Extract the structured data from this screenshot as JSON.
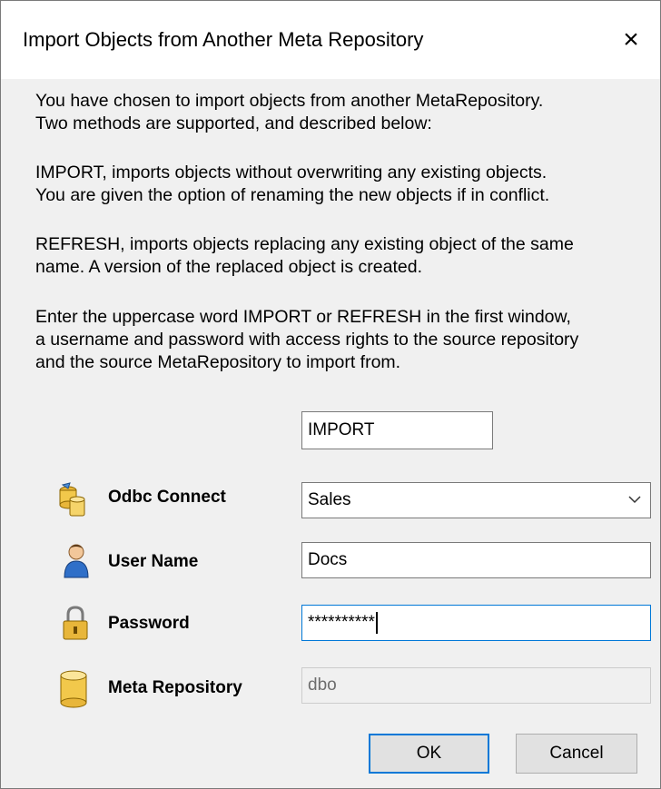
{
  "dialog": {
    "title": "Import Objects from Another Meta Repository",
    "close_glyph": "×"
  },
  "description": {
    "lines": [
      "You have chosen to import objects from another MetaRepository.",
      "Two methods are supported, and described below:",
      "IMPORT, imports objects without overwriting any existing objects.",
      "You are given the option of renaming the new objects if in conflict.",
      "REFRESH, imports objects replacing any existing object of the same",
      "name. A version of the replaced object is created.",
      "Enter the uppercase word IMPORT or REFRESH in the first window,",
      "a username and password with access rights to the source repository",
      "and the source MetaRepository to import from."
    ]
  },
  "form": {
    "mode_value": "IMPORT",
    "odbc": {
      "label": "Odbc Connect",
      "value": "Sales",
      "icon": "database-connect-icon"
    },
    "user": {
      "label": "User Name",
      "value": "Docs",
      "icon": "user-icon"
    },
    "password": {
      "label": "Password",
      "value": "**********",
      "icon": "lock-icon"
    },
    "repository": {
      "label": "Meta Repository",
      "value": "dbo",
      "icon": "database-icon"
    }
  },
  "buttons": {
    "ok": "OK",
    "cancel": "Cancel"
  },
  "colors": {
    "focus_border": "#0078d7",
    "dialog_bg": "#f0f0f0"
  }
}
